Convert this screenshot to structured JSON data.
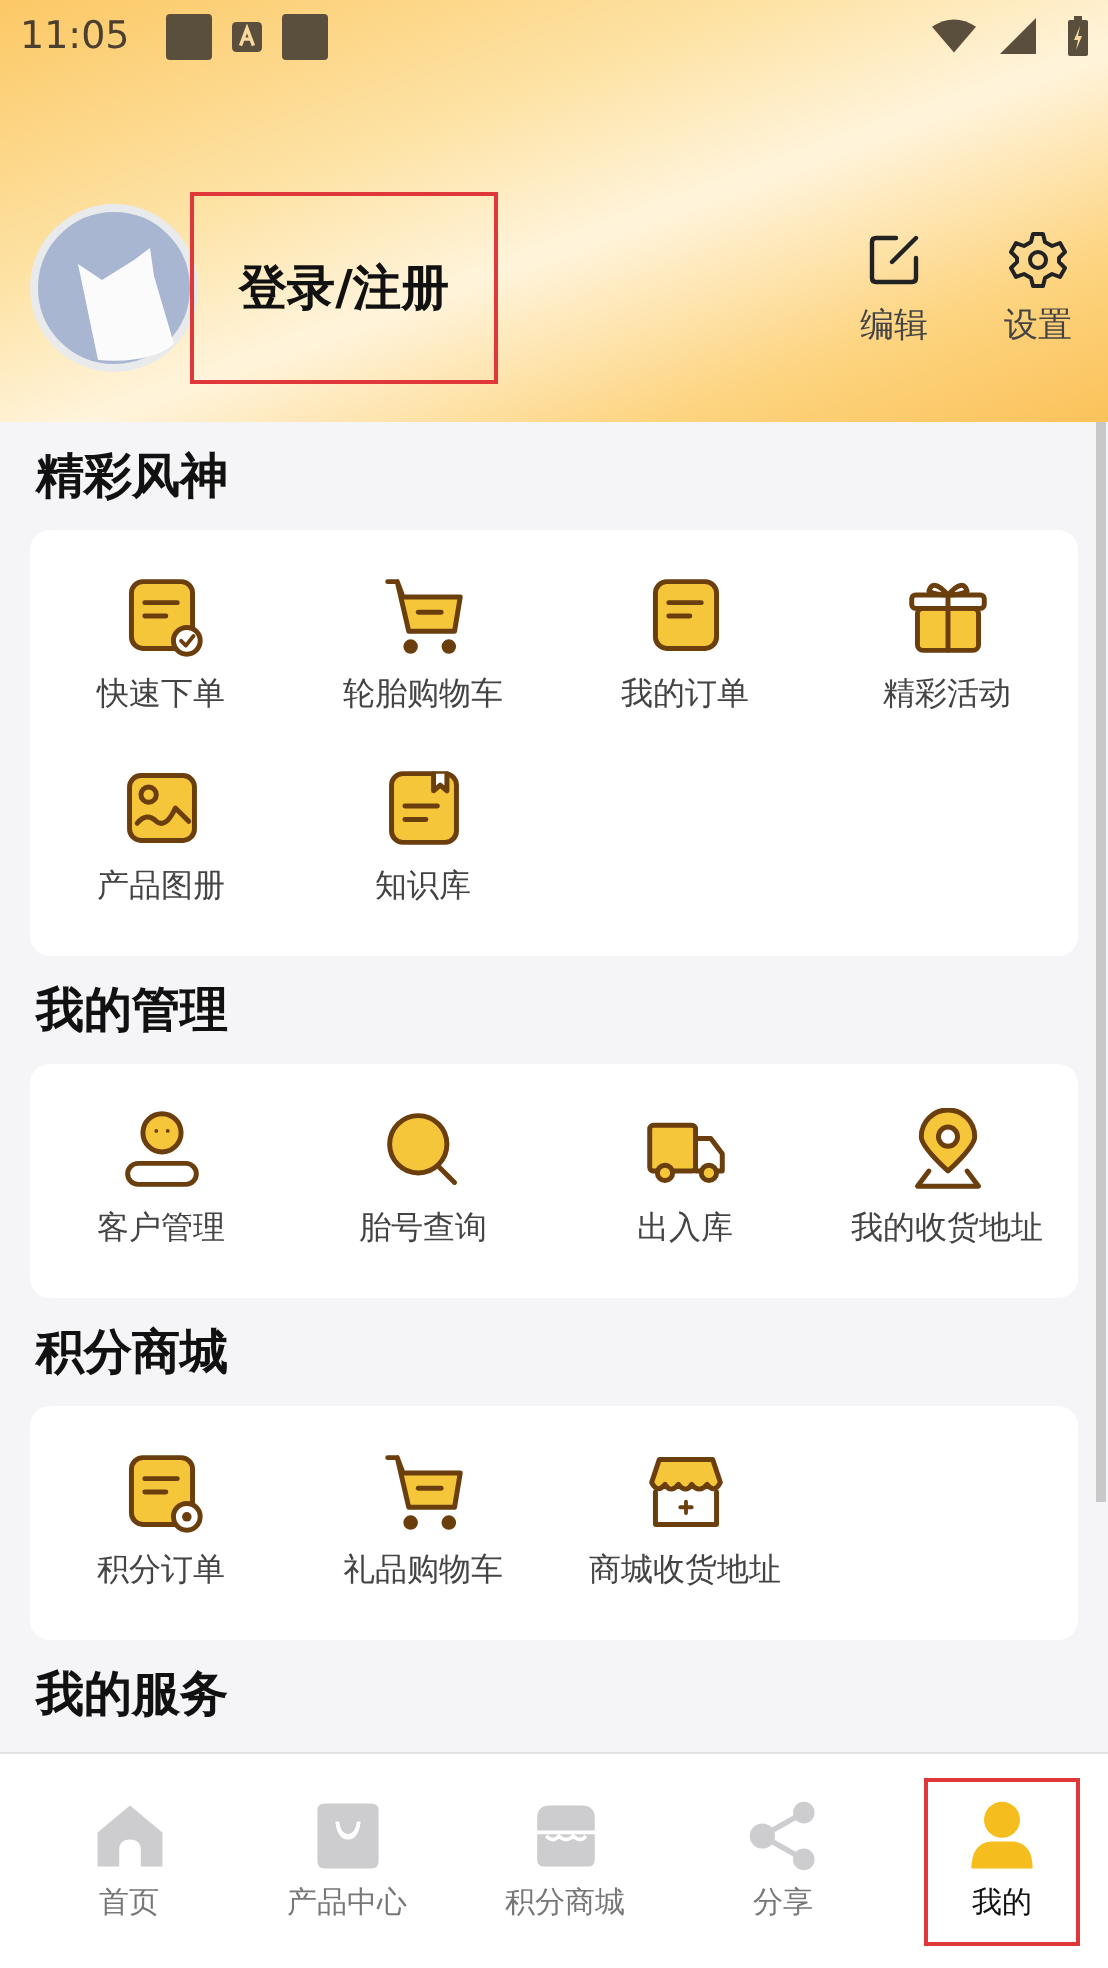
{
  "status_bar": {
    "time": "11:05"
  },
  "profile": {
    "login": "登录/注册",
    "highlighted": true,
    "actions": [
      {
        "label": "编辑"
      },
      {
        "label": "设置"
      }
    ]
  },
  "sections": [
    {
      "title": "精彩风神",
      "items": [
        {
          "label": "快速下单"
        },
        {
          "label": "轮胎购物车"
        },
        {
          "label": "我的订单"
        },
        {
          "label": "精彩活动"
        },
        {
          "label": "产品图册"
        },
        {
          "label": "知识库"
        }
      ]
    },
    {
      "title": "我的管理",
      "items": [
        {
          "label": "客户管理"
        },
        {
          "label": "胎号查询"
        },
        {
          "label": "出入库"
        },
        {
          "label": "我的收货地址"
        }
      ]
    },
    {
      "title": "积分商城",
      "items": [
        {
          "label": "积分订单"
        },
        {
          "label": "礼品购物车"
        },
        {
          "label": "商城收货地址"
        }
      ]
    },
    {
      "title": "我的服务"
    }
  ],
  "tab_bar": [
    {
      "label": "首页",
      "selected": false,
      "highlighted": false
    },
    {
      "label": "产品中心",
      "selected": false,
      "highlighted": false
    },
    {
      "label": "积分商城",
      "selected": false,
      "highlighted": false
    },
    {
      "label": "分享",
      "selected": false,
      "highlighted": false
    },
    {
      "label": "我的",
      "selected": true,
      "highlighted": true
    }
  ]
}
